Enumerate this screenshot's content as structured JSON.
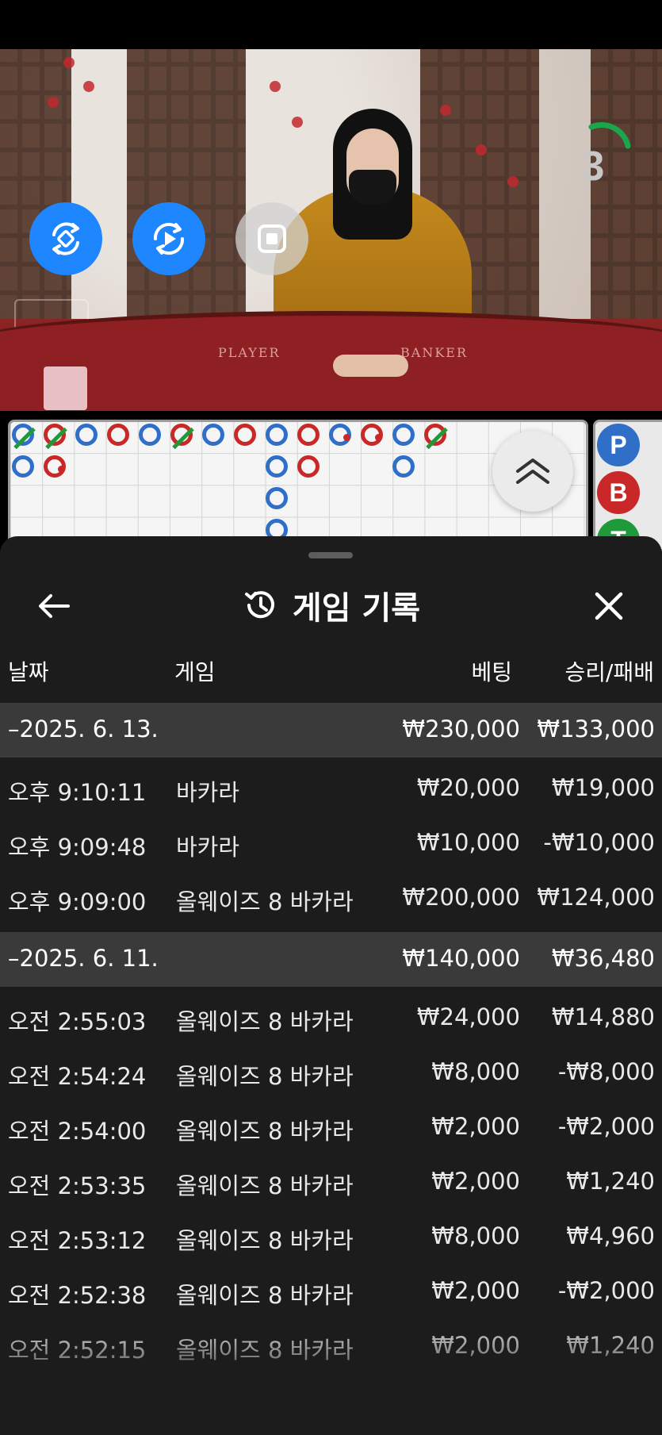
{
  "video": {
    "felt_labels": [
      "PLAYER",
      "BANKER"
    ],
    "countdown": "3",
    "buttons": [
      {
        "icon": "rotate-sync-icon"
      },
      {
        "icon": "autoplay-icon"
      },
      {
        "icon": "stop-icon"
      }
    ]
  },
  "roadmap": {
    "colors": {
      "player": "#2f6fc8",
      "banker": "#c82828",
      "tie": "#1f9a3a"
    },
    "side_chips": [
      "P",
      "B",
      "T"
    ]
  },
  "history": {
    "title": "게임 기록",
    "columns": {
      "date": "날짜",
      "game": "게임",
      "bet": "베팅",
      "winloss": "승리/패배"
    },
    "groups": [
      {
        "date": "–2025. 6. 13.",
        "total_bet": "₩230,000",
        "total_winloss": "₩133,000",
        "rows": [
          {
            "time": "오후 9:10:11",
            "game": "바카라",
            "bet": "₩20,000",
            "winloss": "₩19,000"
          },
          {
            "time": "오후 9:09:48",
            "game": "바카라",
            "bet": "₩10,000",
            "winloss": "-₩10,000"
          },
          {
            "time": "오후 9:09:00",
            "game": "올웨이즈 8 바카라",
            "bet": "₩200,000",
            "winloss": "₩124,000"
          }
        ]
      },
      {
        "date": "–2025. 6. 11.",
        "total_bet": "₩140,000",
        "total_winloss": "₩36,480",
        "rows": [
          {
            "time": "오전 2:55:03",
            "game": "올웨이즈 8 바카라",
            "bet": "₩24,000",
            "winloss": "₩14,880"
          },
          {
            "time": "오전 2:54:24",
            "game": "올웨이즈 8 바카라",
            "bet": "₩8,000",
            "winloss": "-₩8,000"
          },
          {
            "time": "오전 2:54:00",
            "game": "올웨이즈 8 바카라",
            "bet": "₩2,000",
            "winloss": "-₩2,000"
          },
          {
            "time": "오전 2:53:35",
            "game": "올웨이즈 8 바카라",
            "bet": "₩2,000",
            "winloss": "₩1,240"
          },
          {
            "time": "오전 2:53:12",
            "game": "올웨이즈 8 바카라",
            "bet": "₩8,000",
            "winloss": "₩4,960"
          },
          {
            "time": "오전 2:52:38",
            "game": "올웨이즈 8 바카라",
            "bet": "₩2,000",
            "winloss": "-₩2,000"
          },
          {
            "time": "오전 2:52:15",
            "game": "올웨이즈 8 바카라",
            "bet": "₩2,000",
            "winloss": "₩1,240"
          }
        ]
      }
    ]
  }
}
